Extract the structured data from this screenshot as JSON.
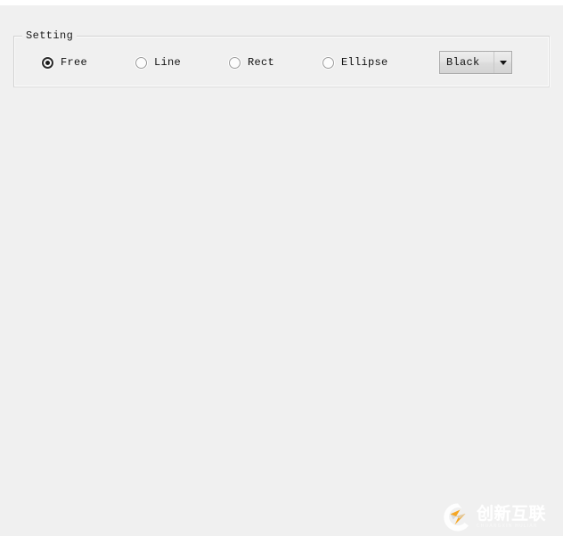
{
  "window": {
    "background_color": "#f0f0f0",
    "title_strip_color": "#ffffff"
  },
  "setting_group": {
    "title": "Setting",
    "border_color": "#dcdcdc",
    "shape_options": [
      {
        "id": "free",
        "label": "Free",
        "checked": true
      },
      {
        "id": "line",
        "label": "Line",
        "checked": false
      },
      {
        "id": "rect",
        "label": "Rect",
        "checked": false
      },
      {
        "id": "ellipse",
        "label": "Ellipse",
        "checked": false
      }
    ],
    "color_select": {
      "value": "Black",
      "arrow_icon": "chevron-down-icon"
    }
  },
  "canvas": {
    "background_color": "#f0f0f0"
  },
  "watermark": {
    "logo_icon": "circle-bolt-logo-icon",
    "title": "创新互联",
    "subtitle": "CHUANGXIN HULIAN",
    "accent_color": "#f5a623",
    "text_color": "#ffffff"
  }
}
